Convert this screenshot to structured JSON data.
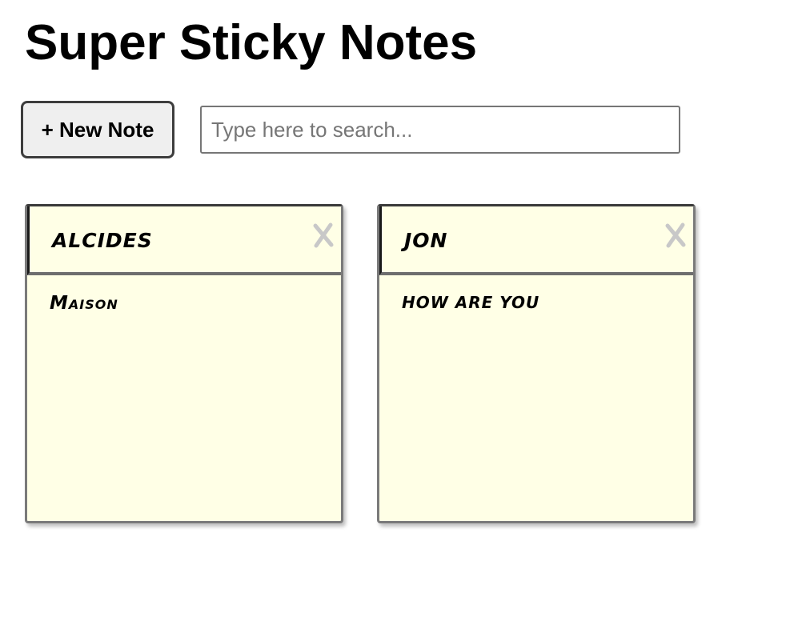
{
  "app": {
    "title": "Super Sticky Notes"
  },
  "toolbar": {
    "new_note_label": "+ New Note",
    "search_placeholder": "Type here to search...",
    "search_value": ""
  },
  "notes": [
    {
      "title": "alcides",
      "body": "Maison",
      "close_icon": "close-x-icon"
    },
    {
      "title": "jon",
      "body": "how are you",
      "close_icon": "close-x-icon"
    }
  ],
  "colors": {
    "note_background": "#ffffe6",
    "close_icon": "#c8c8c8",
    "button_background": "#efefef"
  }
}
